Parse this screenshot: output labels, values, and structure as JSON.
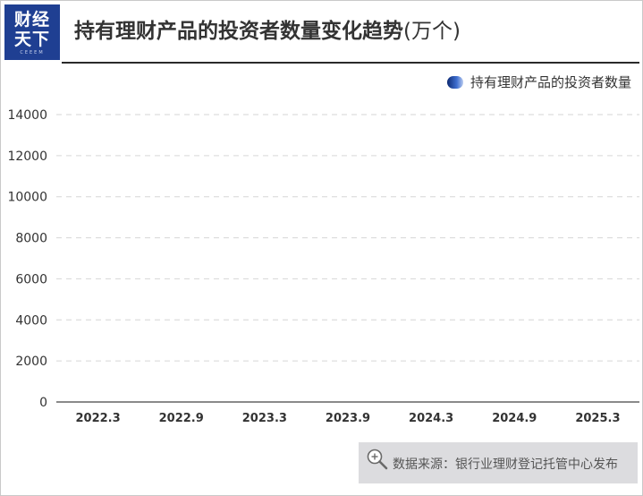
{
  "header": {
    "logo_line1": "财经",
    "logo_line2": "天下",
    "logo_sub": "CEEEM",
    "title": "持有理财产品的投资者数量变化趋势",
    "title_unit": "(万个)"
  },
  "chart_data": {
    "type": "bar",
    "title": "持有理财产品的投资者数量变化趋势(万个)",
    "xlabel": "",
    "ylabel": "",
    "categories": [
      "2022.3",
      "2022.9",
      "2023.3",
      "2023.9",
      "2024.3",
      "2024.9",
      "2025.3"
    ],
    "series": [
      {
        "name": "持有理财产品的投资者数量",
        "values": [
          0,
          0,
          0,
          0,
          0,
          0,
          0
        ]
      }
    ],
    "ylim": [
      0,
      14000
    ],
    "yticks": [
      0,
      2000,
      4000,
      6000,
      8000,
      10000,
      12000,
      14000
    ],
    "grid": true,
    "legend": "top-right",
    "colors": {
      "series": "#2f5bb7",
      "grid": "#d6d6d6",
      "axis": "#444444",
      "tick_text": "#333333"
    }
  },
  "footer": {
    "source": "数据来源：银行业理财登记托管中心发布"
  }
}
